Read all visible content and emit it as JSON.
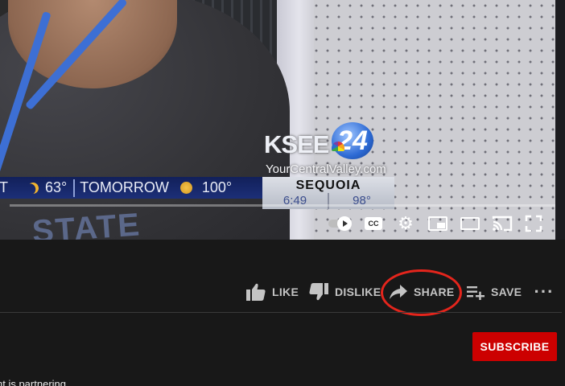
{
  "video": {
    "station": {
      "call_sign": "KSEE",
      "channel": "24",
      "url": "YourCentralValley.com"
    },
    "ticker": {
      "night_temp": "63°",
      "tomorrow_label": "TOMORROW",
      "tomorrow_temp": "100°",
      "partial_prefix": "IT"
    },
    "city_box": {
      "name": "SEQUOIA",
      "time": "6:49",
      "temp": "98°"
    },
    "shirt_print": "STATE",
    "controls": {
      "cc_label": "CC"
    }
  },
  "actions": {
    "like_label": "LIKE",
    "dislike_label": "DISLIKE",
    "share_label": "SHARE",
    "save_label": "SAVE"
  },
  "channel": {
    "subscribe_label": "SUBSCRIBE"
  },
  "description": {
    "snippet": "nt is partnering"
  },
  "colors": {
    "background": "#181818",
    "subscribe": "#cc0000",
    "annotation_circle": "#e4251c",
    "action_text": "#c4c4c4"
  }
}
